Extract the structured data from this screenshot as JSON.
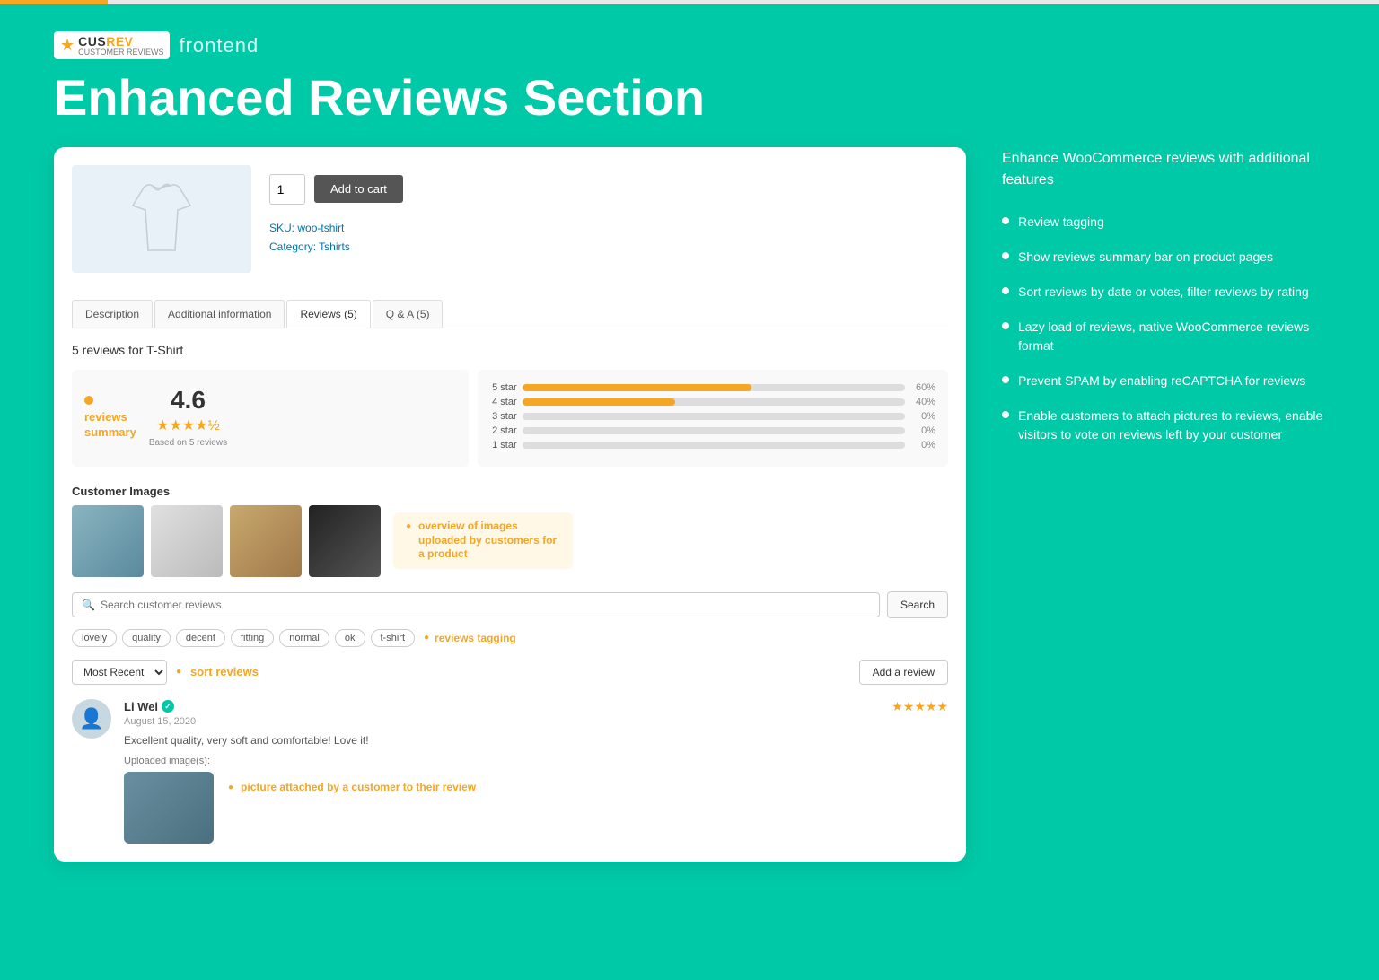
{
  "topBar": {},
  "header": {
    "logo_text": "CUS",
    "logo_text_accent": "REV",
    "logo_sub": "CUSTOMER REVIEWS",
    "frontend_label": "frontend",
    "page_title": "Enhanced Reviews Section"
  },
  "product": {
    "qty": "1",
    "add_to_cart": "Add to cart",
    "sku_label": "SKU:",
    "sku_value": "woo-tshirt",
    "category_label": "Category:",
    "category_value": "Tshirts"
  },
  "tabs": [
    {
      "label": "Description",
      "active": false
    },
    {
      "label": "Additional information",
      "active": false
    },
    {
      "label": "Reviews (5)",
      "active": true
    },
    {
      "label": "Q & A (5)",
      "active": false
    }
  ],
  "reviews_section": {
    "count_label": "5 reviews for T-Shirt",
    "summary": {
      "bullet_label": "reviews\nsummary",
      "score": "4.6",
      "stars": "★★★★½",
      "based_on": "Based on 5 reviews"
    },
    "bars": [
      {
        "label": "5 star",
        "pct": 60,
        "pct_label": "60%",
        "color": "#f5a623"
      },
      {
        "label": "4 star",
        "pct": 40,
        "pct_label": "40%",
        "color": "#f5a623"
      },
      {
        "label": "3 star",
        "pct": 0,
        "pct_label": "0%",
        "color": "#f5a623"
      },
      {
        "label": "2 star",
        "pct": 0,
        "pct_label": "0%",
        "color": "#f5a623"
      },
      {
        "label": "1 star",
        "pct": 0,
        "pct_label": "0%",
        "color": "#f5a623"
      }
    ],
    "customer_images_label": "Customer Images",
    "images_callout": "overview of images uploaded\nby customers for a product",
    "search_placeholder": "Search customer reviews",
    "search_btn": "Search",
    "tags": [
      "lovely",
      "quality",
      "decent",
      "fitting",
      "normal",
      "ok",
      "t-shirt"
    ],
    "tags_callout": "reviews tagging",
    "sort_options": [
      "Most Recent"
    ],
    "sort_selected": "Most Recent",
    "sort_label": "sort reviews",
    "add_review_btn": "Add a review",
    "review": {
      "name": "Li Wei",
      "verified": true,
      "date": "August 15, 2020",
      "stars": "★★★★★",
      "text": "Excellent quality, very soft and comfortable! Love it!",
      "uploaded_label": "Uploaded image(s):",
      "picture_callout": "picture attached by a customer to their review"
    }
  },
  "right_panel": {
    "description": "Enhance WooCommerce reviews with additional features",
    "features": [
      "Review tagging",
      "Show reviews summary bar on product pages",
      "Sort reviews by date or votes, filter reviews by rating",
      "Lazy load of reviews, native WooCommerce reviews format",
      "Prevent SPAM by enabling reCAPTCHA for reviews",
      "Enable customers to attach pictures to reviews, enable visitors to vote on reviews left by your customer"
    ]
  }
}
